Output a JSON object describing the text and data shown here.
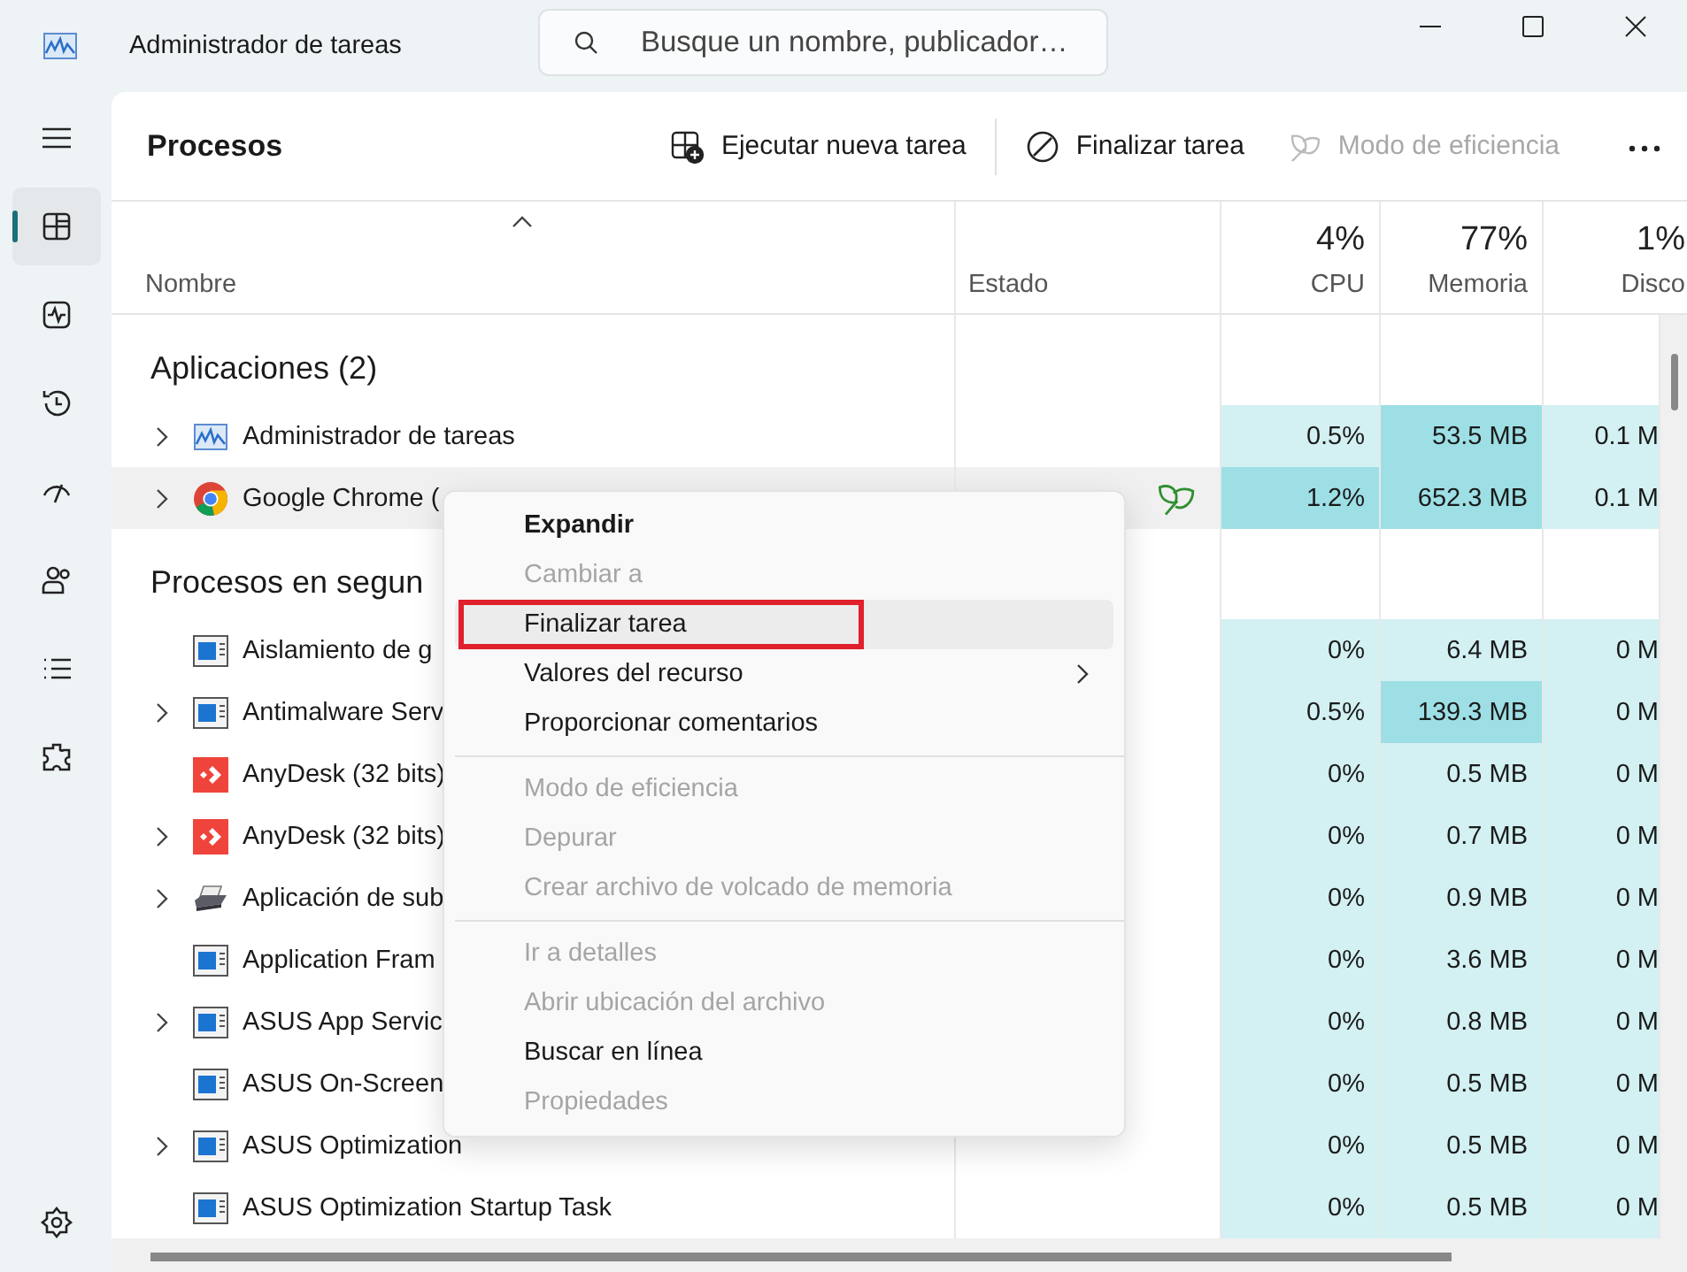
{
  "window": {
    "title": "Administrador de tareas"
  },
  "search": {
    "placeholder": "Busque un nombre, publicador…"
  },
  "sidebar": {
    "items": [
      {
        "selected": false
      },
      {
        "selected": true
      },
      {
        "selected": false
      },
      {
        "selected": false
      },
      {
        "selected": false
      },
      {
        "selected": false
      },
      {
        "selected": false
      },
      {
        "selected": false
      },
      {
        "selected": false
      }
    ]
  },
  "page_title": "Procesos",
  "toolbar": [
    {
      "label": "Ejecutar nueva tarea",
      "disabled": false
    },
    {
      "label": "Finalizar tarea",
      "disabled": false
    },
    {
      "label": "Modo de eficiencia",
      "disabled": true
    }
  ],
  "table": {
    "columns": [
      {
        "label": "Nombre"
      },
      {
        "label": "Estado"
      },
      {
        "label": "CPU",
        "total": "4%"
      },
      {
        "label": "Memoria",
        "total": "77%"
      },
      {
        "label": "Disco",
        "total": "1%"
      }
    ],
    "rows": [
      {
        "kind": "group",
        "name": "Aplicaciones (2)"
      },
      {
        "kind": "taskmgr",
        "name": "Administrador de tareas",
        "expandable": true,
        "selected": false,
        "efficiency": false,
        "cells": [
          {
            "value": "0.5%",
            "high": false
          },
          {
            "value": "53.5 MB",
            "high": true
          },
          {
            "value": "0.1 M",
            "high": false
          }
        ]
      },
      {
        "kind": "chrome",
        "name": "Google Chrome (",
        "expandable": true,
        "selected": true,
        "efficiency": true,
        "cells": [
          {
            "value": "1.2%",
            "high": true
          },
          {
            "value": "652.3 MB",
            "high": true
          },
          {
            "value": "0.1 M",
            "high": false
          }
        ]
      },
      {
        "kind": "group",
        "name": "Procesos en segun"
      },
      {
        "kind": "service",
        "name": "Aislamiento de g",
        "expandable": false,
        "selected": false,
        "efficiency": false,
        "cells": [
          {
            "value": "0%",
            "high": false
          },
          {
            "value": "6.4 MB",
            "high": false
          },
          {
            "value": "0 M",
            "high": false
          }
        ]
      },
      {
        "kind": "service",
        "name": "Antimalware Serv",
        "expandable": true,
        "selected": false,
        "efficiency": false,
        "cells": [
          {
            "value": "0.5%",
            "high": false
          },
          {
            "value": "139.3 MB",
            "high": true
          },
          {
            "value": "0 M",
            "high": false
          }
        ]
      },
      {
        "kind": "anydesk",
        "name": "AnyDesk (32 bits)",
        "expandable": false,
        "selected": false,
        "efficiency": false,
        "cells": [
          {
            "value": "0%",
            "high": false
          },
          {
            "value": "0.5 MB",
            "high": false
          },
          {
            "value": "0 M",
            "high": false
          }
        ]
      },
      {
        "kind": "anydesk",
        "name": "AnyDesk (32 bits)",
        "expandable": true,
        "selected": false,
        "efficiency": false,
        "cells": [
          {
            "value": "0%",
            "high": false
          },
          {
            "value": "0.7 MB",
            "high": false
          },
          {
            "value": "0 M",
            "high": false
          }
        ]
      },
      {
        "kind": "printer",
        "name": "Aplicación de sub",
        "expandable": true,
        "selected": false,
        "efficiency": false,
        "cells": [
          {
            "value": "0%",
            "high": false
          },
          {
            "value": "0.9 MB",
            "high": false
          },
          {
            "value": "0 M",
            "high": false
          }
        ]
      },
      {
        "kind": "service",
        "name": "Application Fram",
        "expandable": false,
        "selected": false,
        "efficiency": false,
        "cells": [
          {
            "value": "0%",
            "high": false
          },
          {
            "value": "3.6 MB",
            "high": false
          },
          {
            "value": "0 M",
            "high": false
          }
        ]
      },
      {
        "kind": "service",
        "name": "ASUS App Servic",
        "expandable": true,
        "selected": false,
        "efficiency": false,
        "cells": [
          {
            "value": "0%",
            "high": false
          },
          {
            "value": "0.8 MB",
            "high": false
          },
          {
            "value": "0 M",
            "high": false
          }
        ]
      },
      {
        "kind": "service",
        "name": "ASUS On-Screen",
        "expandable": false,
        "selected": false,
        "efficiency": false,
        "cells": [
          {
            "value": "0%",
            "high": false
          },
          {
            "value": "0.5 MB",
            "high": false
          },
          {
            "value": "0 M",
            "high": false
          }
        ]
      },
      {
        "kind": "service",
        "name": "ASUS Optimization",
        "expandable": true,
        "selected": false,
        "efficiency": false,
        "cells": [
          {
            "value": "0%",
            "high": false
          },
          {
            "value": "0.5 MB",
            "high": false
          },
          {
            "value": "0 M",
            "high": false
          }
        ]
      },
      {
        "kind": "service",
        "name": "ASUS Optimization Startup Task",
        "expandable": false,
        "selected": false,
        "efficiency": false,
        "cells": [
          {
            "value": "0%",
            "high": false
          },
          {
            "value": "0.5 MB",
            "high": false
          },
          {
            "value": "0 M",
            "high": false
          }
        ]
      }
    ]
  },
  "context_menu": {
    "items": [
      {
        "kind": "item",
        "label": "Expandir",
        "default": true,
        "disabled": false,
        "selected": false
      },
      {
        "kind": "item",
        "label": "Cambiar a",
        "disabled": true,
        "selected": false
      },
      {
        "kind": "item",
        "label": "Finalizar tarea",
        "disabled": false,
        "selected": true,
        "outlined": true
      },
      {
        "kind": "item",
        "label": "Valores del recurso",
        "disabled": false,
        "selected": false,
        "submenu": true
      },
      {
        "kind": "item",
        "label": "Proporcionar comentarios",
        "disabled": false,
        "selected": false
      },
      {
        "kind": "separator"
      },
      {
        "kind": "item",
        "label": "Modo de eficiencia",
        "disabled": true,
        "selected": false
      },
      {
        "kind": "item",
        "label": "Depurar",
        "disabled": true,
        "selected": false
      },
      {
        "kind": "item",
        "label": "Crear archivo de volcado de memoria",
        "disabled": true,
        "selected": false
      },
      {
        "kind": "separator"
      },
      {
        "kind": "item",
        "label": "Ir a detalles",
        "disabled": true,
        "selected": false
      },
      {
        "kind": "item",
        "label": "Abrir ubicación del archivo",
        "disabled": true,
        "selected": false
      },
      {
        "kind": "item",
        "label": "Buscar en línea",
        "disabled": false,
        "selected": false
      },
      {
        "kind": "item",
        "label": "Propiedades",
        "disabled": true,
        "selected": false
      }
    ]
  }
}
